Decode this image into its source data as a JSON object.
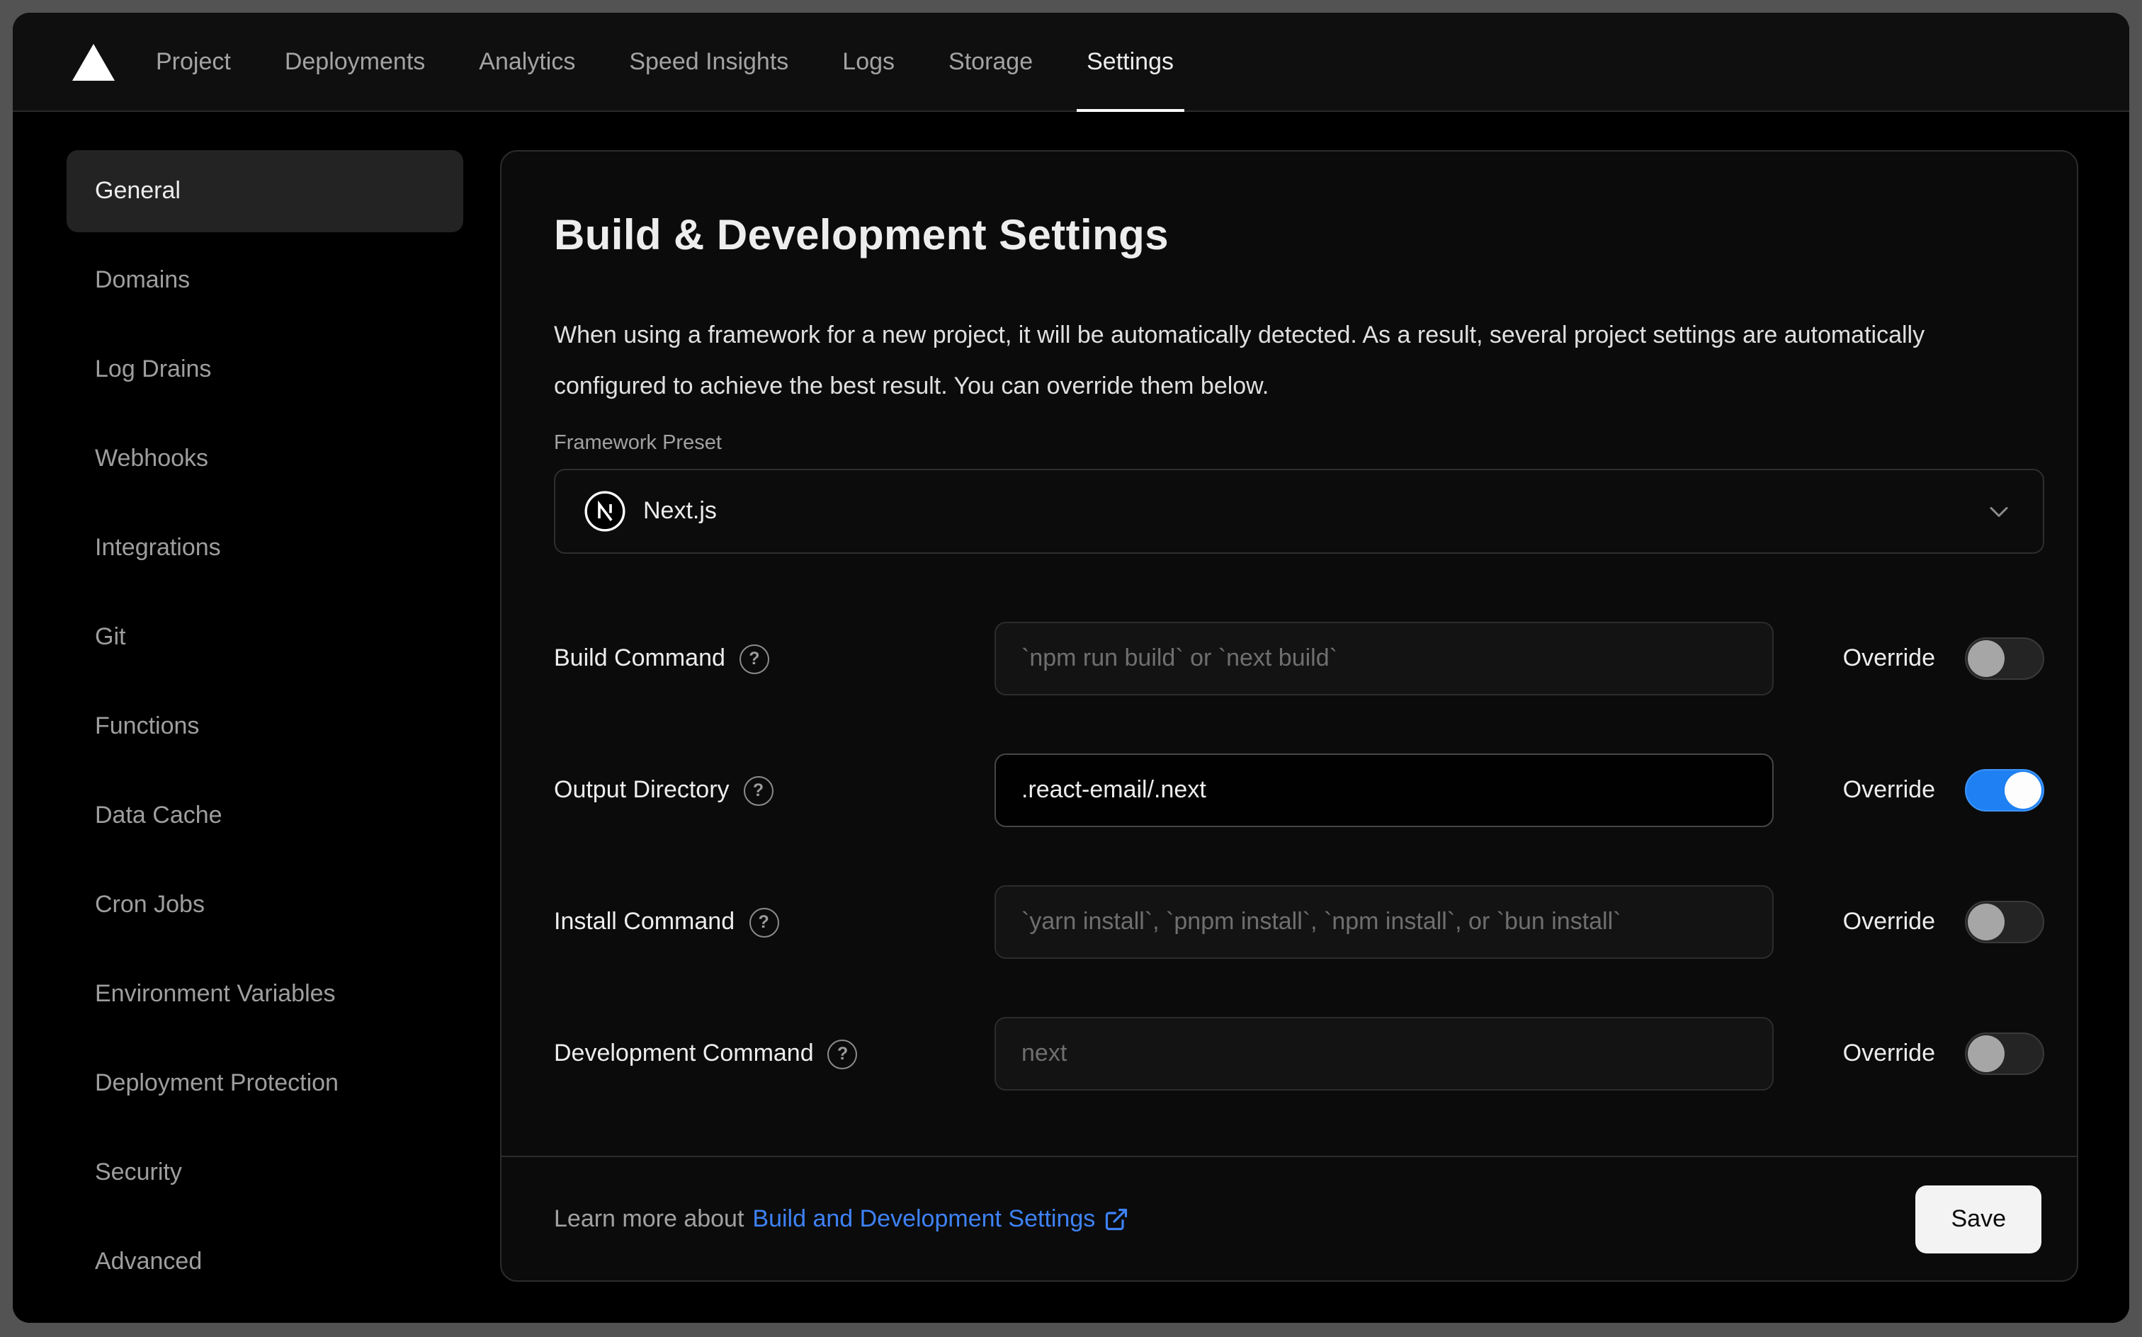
{
  "navbar": {
    "items": [
      {
        "label": "Project",
        "active": false
      },
      {
        "label": "Deployments",
        "active": false
      },
      {
        "label": "Analytics",
        "active": false
      },
      {
        "label": "Speed Insights",
        "active": false
      },
      {
        "label": "Logs",
        "active": false
      },
      {
        "label": "Storage",
        "active": false
      },
      {
        "label": "Settings",
        "active": true
      }
    ]
  },
  "sidebar": {
    "items": [
      {
        "label": "General",
        "selected": true
      },
      {
        "label": "Domains",
        "selected": false
      },
      {
        "label": "Log Drains",
        "selected": false
      },
      {
        "label": "Webhooks",
        "selected": false
      },
      {
        "label": "Integrations",
        "selected": false
      },
      {
        "label": "Git",
        "selected": false
      },
      {
        "label": "Functions",
        "selected": false
      },
      {
        "label": "Data Cache",
        "selected": false
      },
      {
        "label": "Cron Jobs",
        "selected": false
      },
      {
        "label": "Environment Variables",
        "selected": false
      },
      {
        "label": "Deployment Protection",
        "selected": false
      },
      {
        "label": "Security",
        "selected": false
      },
      {
        "label": "Advanced",
        "selected": false
      }
    ]
  },
  "main": {
    "title": "Build & Development Settings",
    "description": "When using a framework for a new project, it will be automatically detected. As a result, several project settings are automatically configured to achieve the best result. You can override them below.",
    "framework_preset": {
      "label": "Framework Preset",
      "value": "Next.js",
      "icon": "nextjs-logo"
    },
    "rows": [
      {
        "label": "Build Command",
        "placeholder": "`npm run build` or `next build`",
        "value": "",
        "override_label": "Override",
        "override_on": false
      },
      {
        "label": "Output Directory",
        "placeholder": "",
        "value": ".react-email/.next",
        "override_label": "Override",
        "override_on": true
      },
      {
        "label": "Install Command",
        "placeholder": "`yarn install`, `pnpm install`, `npm install`, or `bun install`",
        "value": "",
        "override_label": "Override",
        "override_on": false
      },
      {
        "label": "Development Command",
        "placeholder": "next",
        "value": "",
        "override_label": "Override",
        "override_on": false
      }
    ],
    "footer": {
      "learn_more_prefix": "Learn more about",
      "link_label": "Build and Development Settings",
      "save_label": "Save"
    }
  },
  "icons": {
    "help_glyph": "?"
  },
  "colors": {
    "accent_blue": "#1e80f2",
    "link_blue": "#3e82f6",
    "frame_gray": "#535353",
    "panel_bg": "#0b0b0b",
    "save_button_bg": "#f3f3f3"
  }
}
